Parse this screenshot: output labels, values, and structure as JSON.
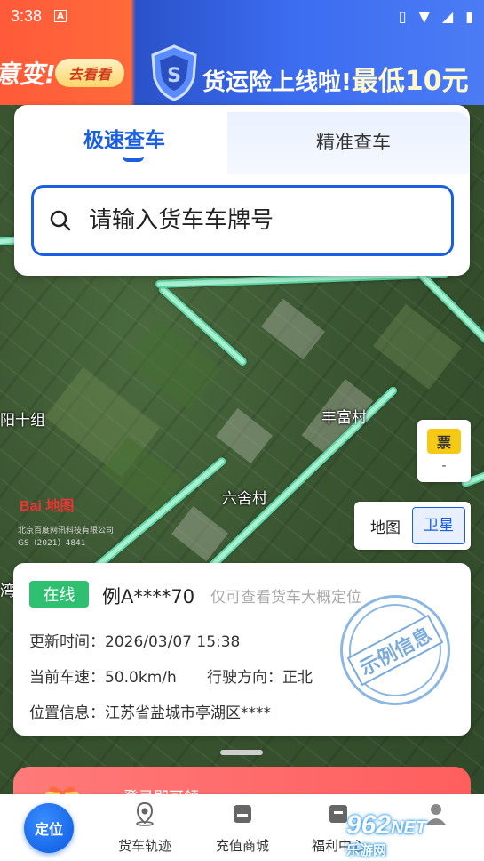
{
  "status_bar": {
    "time": "3:38",
    "notif_letter": "A"
  },
  "banner": {
    "left_text": "意变!",
    "go_button": "去看看",
    "main_text": "货运险上线啦!",
    "main_text_big": "最低10元"
  },
  "search": {
    "tab_fast": "极速查车",
    "tab_precise": "精准查车",
    "placeholder": "请输入货车车牌号"
  },
  "map": {
    "labels": {
      "yang": "阳十组",
      "fengfu": "丰富村",
      "liushe": "六舍村",
      "wan": "湾"
    },
    "logo": "Bai 地图",
    "copyright_1": "北京百度网讯科技有限公司",
    "copyright_2": "GS（2021）4841",
    "ticket_badge": "票",
    "ticket_value": "-",
    "type_map": "地图",
    "type_satellite": "卫星"
  },
  "vehicle": {
    "status": "在线",
    "plate": "例A****70",
    "hint": "仅可查看货车大概定位",
    "update_label": "更新时间：",
    "update_value": "2026/03/07 15:38",
    "speed_label": "当前车速：",
    "speed_value": "50.0km/h",
    "direction_label": "行驶方向：",
    "direction_value": "正北",
    "location_label": "位置信息：",
    "location_value": "江苏省盐城市亭湖区****",
    "stamp": "示例信息"
  },
  "promo": {
    "text": "登录即可领"
  },
  "nav": {
    "locate": "定位",
    "track": "货车轨迹",
    "mall": "充值商城",
    "welfare": "福利中心"
  },
  "watermark": {
    "main": "962",
    "suffix": "NET",
    "sub": "乐游网"
  },
  "colors": {
    "accent": "#1a5fe0",
    "online": "#2fbf71",
    "road": "#a7f0d0"
  }
}
